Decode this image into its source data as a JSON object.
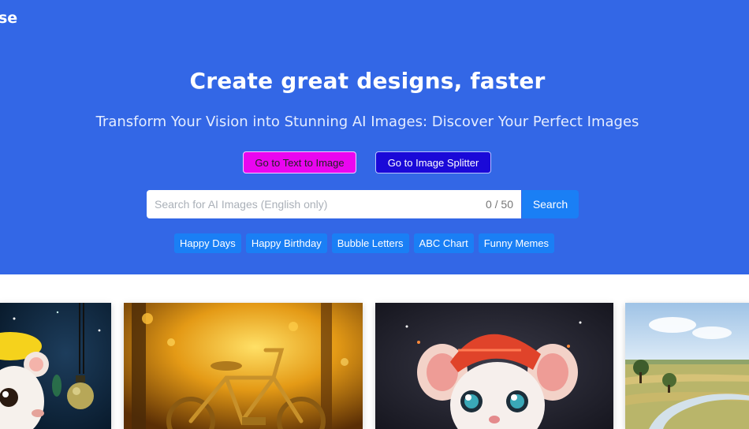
{
  "brand": {
    "logo_text": "se"
  },
  "hero": {
    "title": "Create great designs, faster",
    "subtitle": "Transform Your Vision into Stunning AI Images: Discover Your Perfect Images",
    "buttons": {
      "text_to_image": "Go to Text to Image",
      "image_splitter": "Go to Image Splitter"
    },
    "search": {
      "placeholder": "Search for AI Images (English only)",
      "value": "",
      "counter": "0 / 50",
      "button_label": "Search"
    },
    "chips": [
      "Happy Days",
      "Happy Birthday",
      "Bubble Letters",
      "ABC Chart",
      "Funny Memes"
    ]
  },
  "colors": {
    "hero_bg": "#3367e6",
    "text_to_image_btn": "#ea05f0",
    "image_splitter_btn": "#1a09d8",
    "accent": "#1a7ff5"
  },
  "gallery": {
    "images": [
      {
        "icon": "cartoon-mouse-yellow-hat-image"
      },
      {
        "icon": "golden-bicycle-autumn-image"
      },
      {
        "icon": "cartoon-mouse-red-hat-image"
      },
      {
        "icon": "countryside-river-landscape-image"
      }
    ]
  }
}
